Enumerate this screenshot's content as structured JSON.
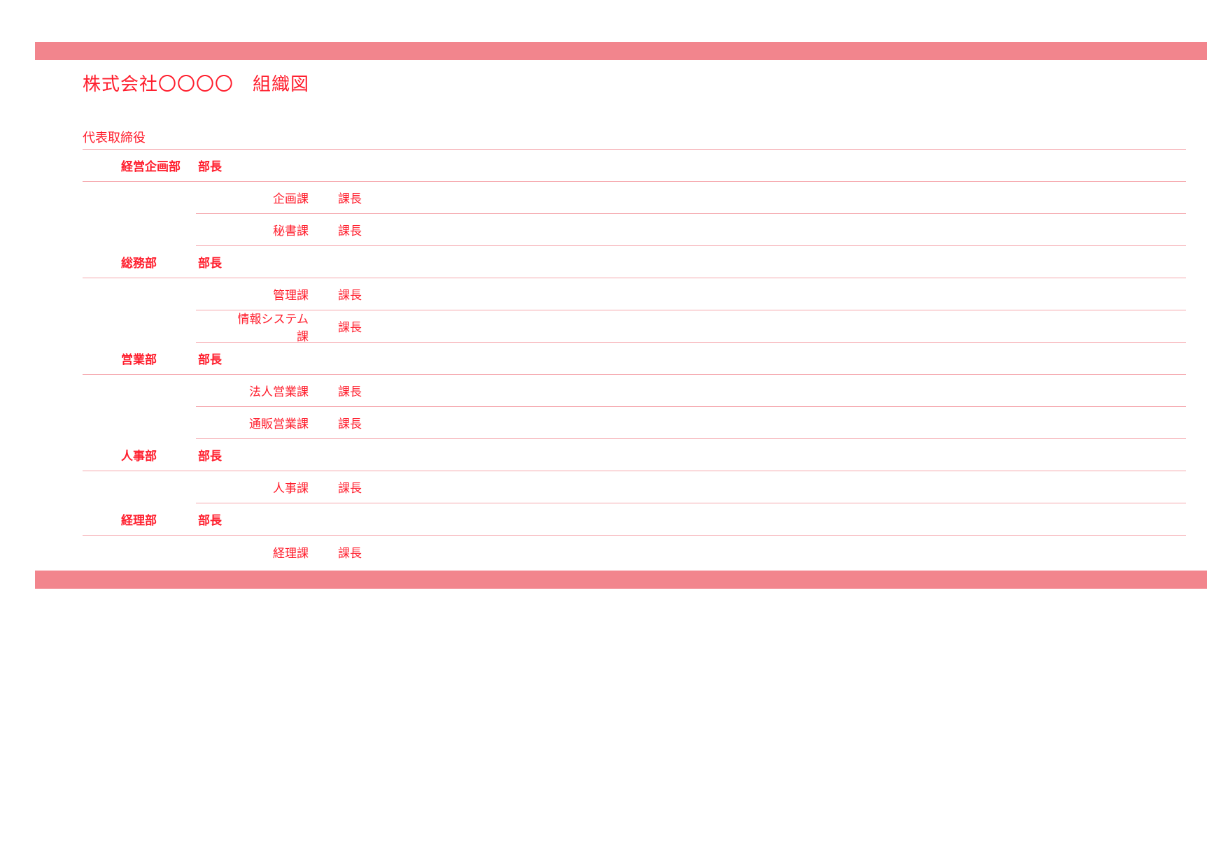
{
  "title": "株式会社〇〇〇〇　組織図",
  "root": "代表取締役",
  "departments": [
    {
      "name": "経営企画部",
      "role": "部長",
      "sections": [
        {
          "name": "企画課",
          "role": "課長"
        },
        {
          "name": "秘書課",
          "role": "課長"
        }
      ]
    },
    {
      "name": "総務部",
      "role": "部長",
      "sections": [
        {
          "name": "管理課",
          "role": "課長"
        },
        {
          "name": "情報システム課",
          "role": "課長"
        }
      ]
    },
    {
      "name": "営業部",
      "role": "部長",
      "sections": [
        {
          "name": "法人営業課",
          "role": "課長"
        },
        {
          "name": "通販営業課",
          "role": "課長"
        }
      ]
    },
    {
      "name": "人事部",
      "role": "部長",
      "sections": [
        {
          "name": "人事課",
          "role": "課長"
        }
      ]
    },
    {
      "name": "経理部",
      "role": "部長",
      "sections": [
        {
          "name": "経理課",
          "role": "課長"
        }
      ]
    }
  ]
}
